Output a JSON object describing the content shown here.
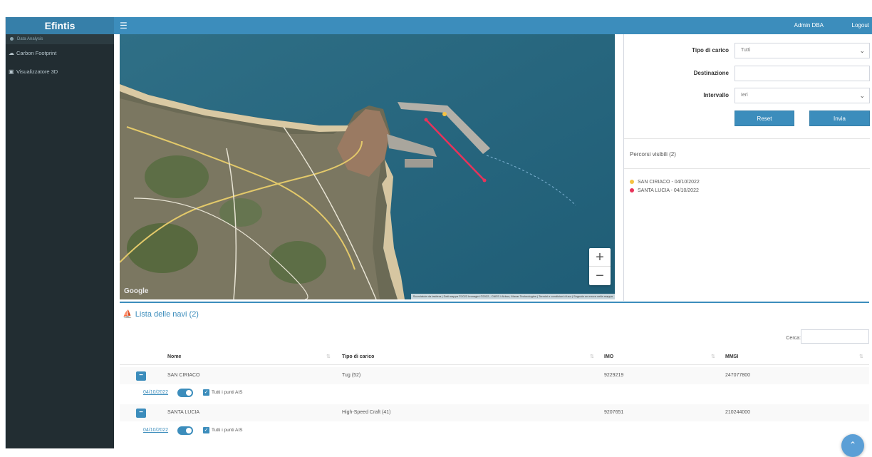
{
  "brand": "Efintis",
  "header": {
    "menu_icon": "hamburger-icon",
    "user": "Admin DBA",
    "logout": "Logout"
  },
  "sidebar": {
    "section": "Data Analysis",
    "items": [
      {
        "label": "Carbon Footprint",
        "icon": "cloud-icon"
      },
      {
        "label": "Visualizzatore 3D",
        "icon": "cube-icon"
      }
    ]
  },
  "map": {
    "logo": "Google",
    "attribution": "Scorciatoie da tastiera | Dati mappa ©2022 Immagini ©2022 , CNES / Airbus, Maxar Technologies | Termini e condizioni d'uso | Segnala un errore nella mappa",
    "zoom_in": "+",
    "zoom_out": "−"
  },
  "filters": {
    "tipo_label": "Tipo di carico",
    "tipo_value": "Tutti",
    "dest_label": "Destinazione",
    "dest_value": "",
    "intervallo_label": "Intervallo",
    "intervallo_value": "Ieri",
    "reset": "Reset",
    "invia": "Invia"
  },
  "routes": {
    "title": "Percorsi visibili (2)",
    "items": [
      {
        "label": "SAN CIRIACO - 04/10/2022",
        "color": "#f5c242"
      },
      {
        "label": "SANTA LUCIA - 04/10/2022",
        "color": "#e8335a"
      }
    ]
  },
  "ships": {
    "title": "Lista delle navi (2)",
    "search_label": "Cerca:",
    "search_value": "",
    "columns": [
      "Nome",
      "Tipo di carico",
      "IMO",
      "MMSI"
    ],
    "rows": [
      {
        "nome": "SAN CIRIACO",
        "tipo": "Tug (52)",
        "imo": "9229219",
        "mmsi": "247077800",
        "date": "04/10/2022",
        "ais": "Tutti i punti AIS"
      },
      {
        "nome": "SANTA LUCIA",
        "tipo": "High-Speed Craft (41)",
        "imo": "9207651",
        "mmsi": "210244000",
        "date": "04/10/2022",
        "ais": "Tutti i punti AIS"
      }
    ]
  },
  "colors": {
    "accent": "#3c8dbc",
    "sidebar": "#222d32"
  }
}
